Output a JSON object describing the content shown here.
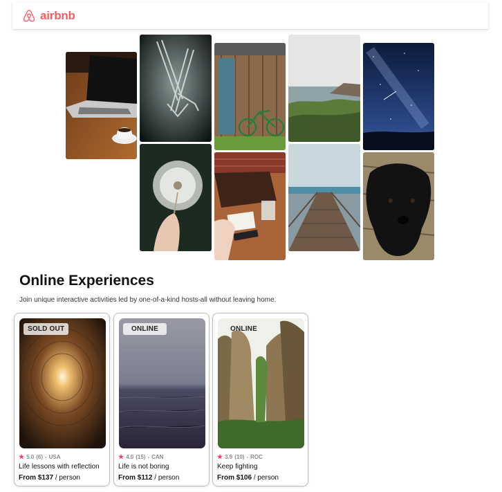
{
  "header": {
    "brand": "airbnb",
    "logo_icon": "airbnb-logo-icon",
    "brand_color": "#ff5a5f"
  },
  "gallery": {
    "photos": [
      {
        "name": "laptop-coffee-photo"
      },
      {
        "name": "forks-photo"
      },
      {
        "name": "dandelion-photo"
      },
      {
        "name": "wooden-door-bicycle-photo"
      },
      {
        "name": "desk-notebook-photo"
      },
      {
        "name": "seaside-cliff-photo"
      },
      {
        "name": "pier-photo"
      },
      {
        "name": "starry-sky-photo"
      },
      {
        "name": "black-puppy-photo"
      }
    ]
  },
  "experiences": {
    "title": "Online Experiences",
    "subtitle": "Join unique interactive activities led by one-of-a-kind hosts-all without leaving home.",
    "cards": [
      {
        "badge": "SOLD OUT",
        "rating": "5.0",
        "reviews": "(6)",
        "country": "USA",
        "title": "Life lessons with reflection",
        "price_prefix": "From $137",
        "price_suffix": "/ person"
      },
      {
        "badge": "ONLINE",
        "rating": "4.0",
        "reviews": "(15)",
        "country": "CAN",
        "title": "Life is not boring",
        "price_prefix": "From $112",
        "price_suffix": "/ person"
      },
      {
        "badge": "ONLINE",
        "rating": "3.9",
        "reviews": "(10)",
        "country": "ROC",
        "title": "Keep fighting",
        "price_prefix": "From $106",
        "price_suffix": "/ person"
      }
    ],
    "star_color": "#ff385c"
  }
}
